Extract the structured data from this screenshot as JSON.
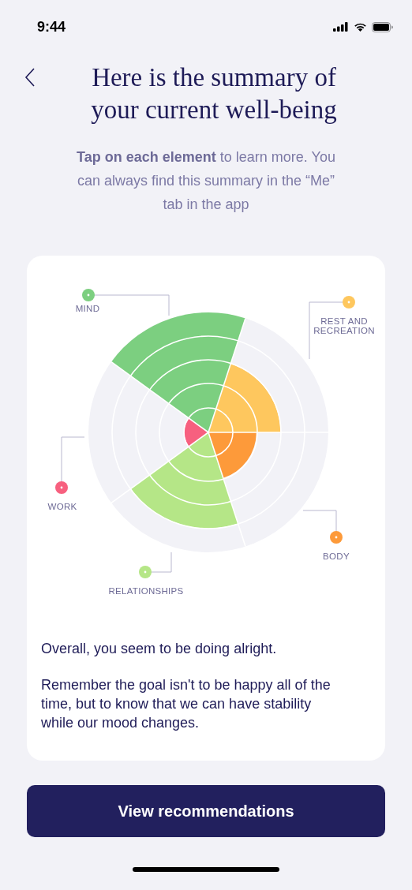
{
  "status_bar": {
    "time": "9:44"
  },
  "title": "Here is the summary of your current well-being",
  "intro": "**Tap on each element** to learn more. You can always find this summary in the “Me” tab in the app",
  "areas": [
    {
      "label": "MIND",
      "color": "#7ccf80"
    },
    {
      "label": "REST AND RECREATION",
      "color": "#fec75e"
    },
    {
      "label": "BODY",
      "color": "#fd9a3a"
    },
    {
      "label": "RELATIONSHIPS",
      "color": "#b5e687"
    },
    {
      "label": "WORK",
      "color": "#f7607f"
    }
  ],
  "summary": [
    "Overall, you seem to be doing alright.",
    "Remember the goal isn't to be happy all of the time, but to know that we can have stability while our mood changes."
  ],
  "button": "View recommendations"
}
